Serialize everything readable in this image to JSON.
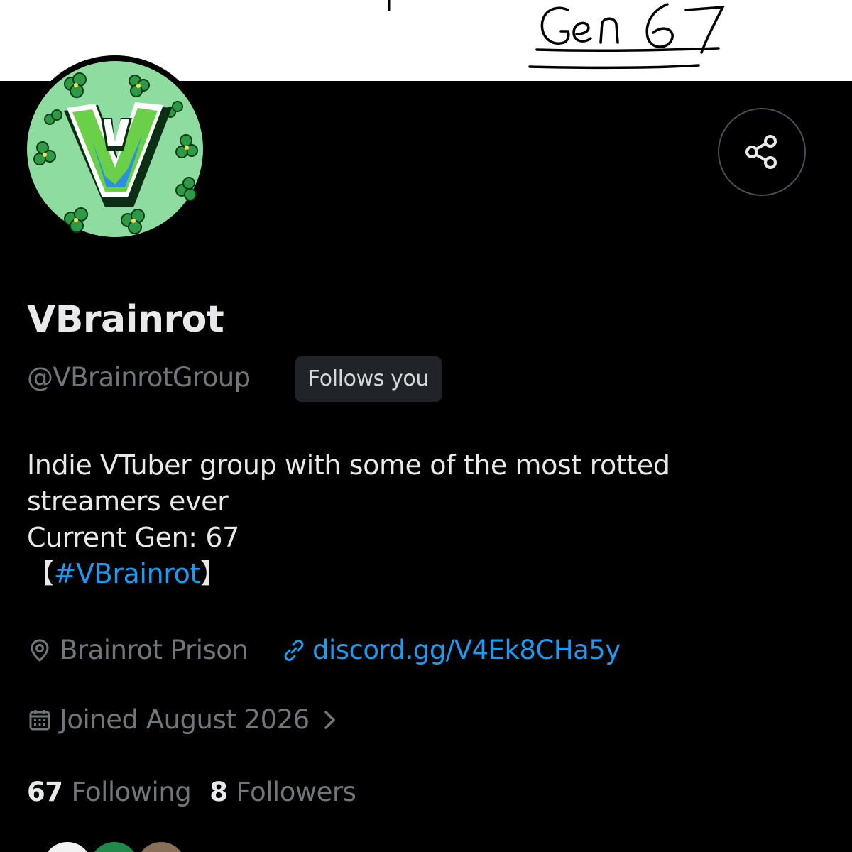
{
  "banner": {
    "handwriting": "Gen 67"
  },
  "profile": {
    "display_name": "VBrainrot",
    "handle": "@VBrainrotGroup",
    "follows_you": "Follows you",
    "bio_lines": [
      "Indie VTuber group with some of the most rotted",
      "streamers ever",
      "Current Gen: 67"
    ],
    "hashtag_open": "【",
    "hashtag": "#VBrainrot",
    "hashtag_close": "】",
    "location": "Brainrot Prison",
    "link": "discord.gg/V4Ek8CHa5y",
    "joined": "Joined August 2026"
  },
  "stats": {
    "following_count": "67",
    "following_label": "Following",
    "followers_count": "8",
    "followers_label": "Followers"
  },
  "icons": {
    "share": "share-icon",
    "location": "location-pin-icon",
    "link": "link-icon",
    "calendar": "calendar-icon",
    "chevron": "chevron-right-icon"
  },
  "colors": {
    "background": "#000000",
    "accent_blue": "#1d9bf0",
    "text_primary": "#e7e9ea",
    "text_secondary": "#71767b",
    "avatar_green": "#8fdca0"
  }
}
